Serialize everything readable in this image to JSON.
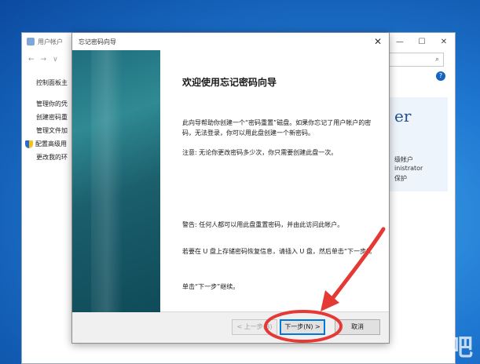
{
  "background_window": {
    "title": "用户帐户",
    "min_icon": "minimize-icon",
    "max_icon": "maximize-icon",
    "close_icon": "close-icon",
    "nav_back": "←",
    "nav_forward": "→",
    "nav_down": "∨",
    "search_icon": "⌕",
    "help": "?",
    "sidebar": {
      "home": "控制面板主",
      "links": [
        "管理你的凭",
        "创建密码重",
        "管理文件加",
        "配置高级用",
        "更改我的环"
      ]
    },
    "card": {
      "big": "er",
      "lines": [
        "级帐户",
        "inistrator",
        "保护"
      ]
    }
  },
  "wizard": {
    "title": "忘记密码向导",
    "close": "✕",
    "heading": "欢迎使用忘记密码向导",
    "paragraphs": [
      "此向导帮助你创建一个“密码重置”磁盘。如果你忘记了用户帐户的密码，无法登录，你可以用此盘创建一个新密码。",
      "注意: 无论你更改密码多少次，你只需要创建此盘一次。",
      "警告: 任何人都可以用此盘重置密码，并由此访问此帐户。",
      "若要在 U 盘上存储密码恢复信息，请插入 U 盘，然后单击“下一步”。",
      "单击“下一步”继续。"
    ],
    "buttons": {
      "back": "< 上一步(B)",
      "next": "下一步(N) >",
      "cancel": "取消"
    }
  },
  "watermark": "下载吧",
  "colors": {
    "annotation": "#e53935",
    "banner": "#1f6e7e",
    "accent": "#0078d7"
  }
}
